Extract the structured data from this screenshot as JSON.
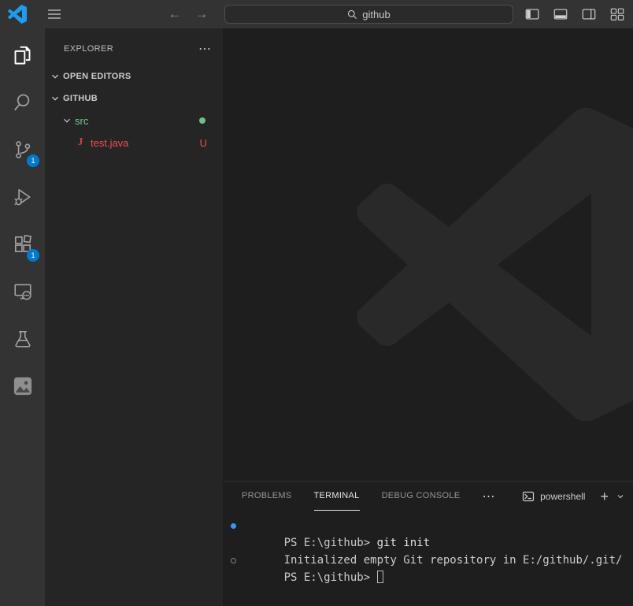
{
  "titlebar": {
    "search_value": "github"
  },
  "activity_bar": {
    "items": [
      {
        "id": "explorer",
        "active": true
      },
      {
        "id": "search"
      },
      {
        "id": "source-control",
        "badge": "1"
      },
      {
        "id": "run-and-debug"
      },
      {
        "id": "extensions",
        "badge": "1"
      },
      {
        "id": "remote-explorer"
      },
      {
        "id": "testing"
      },
      {
        "id": "image-extension"
      }
    ]
  },
  "sidebar": {
    "title": "EXPLORER",
    "more": "⋯",
    "sections": [
      {
        "label": "OPEN EDITORS"
      },
      {
        "label": "GITHUB"
      }
    ],
    "tree": {
      "folder": {
        "label": "src"
      },
      "file": {
        "label": "test.java",
        "icon": "J",
        "badge": "U"
      }
    }
  },
  "panel": {
    "tabs": [
      {
        "label": "PROBLEMS",
        "active": false
      },
      {
        "label": "TERMINAL",
        "active": true
      },
      {
        "label": "DEBUG CONSOLE",
        "active": false
      }
    ],
    "more": "⋯",
    "shell": {
      "label": "powershell"
    },
    "actions": {
      "new": "+"
    }
  },
  "terminal": {
    "lines": [
      {
        "prompt": "PS E:\\github> ",
        "command": "git init"
      },
      {
        "text": "Initialized empty Git repository in E:/github/.git/"
      },
      {
        "prompt": "PS E:\\github> ",
        "command": ""
      }
    ]
  },
  "colors": {
    "titlebar": "#333334",
    "activity_bar": "#333333",
    "sidebar": "#252526",
    "editor": "#1e1e1e",
    "badge_blue": "#007acc",
    "untracked_green": "#73c991",
    "error_red": "#f14c4c",
    "command_decoration_blue": "#3794ff"
  }
}
